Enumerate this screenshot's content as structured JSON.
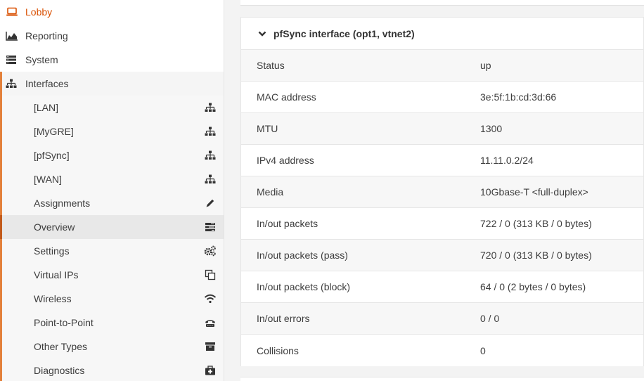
{
  "sidebar": {
    "top_items": [
      {
        "label": "Lobby",
        "icon": "laptop-icon",
        "active": true
      },
      {
        "label": "Reporting",
        "icon": "area-chart-icon"
      },
      {
        "label": "System",
        "icon": "server-icon"
      },
      {
        "label": "Interfaces",
        "icon": "sitemap-icon"
      }
    ],
    "interfaces_submenu": [
      {
        "label": "[LAN]",
        "icon": "sitemap-icon"
      },
      {
        "label": "[MyGRE]",
        "icon": "sitemap-icon"
      },
      {
        "label": "[pfSync]",
        "icon": "sitemap-icon"
      },
      {
        "label": "[WAN]",
        "icon": "sitemap-icon"
      },
      {
        "label": "Assignments",
        "icon": "pencil-icon"
      },
      {
        "label": "Overview",
        "icon": "tasks-icon",
        "selected": true
      },
      {
        "label": "Settings",
        "icon": "cogs-icon"
      },
      {
        "label": "Virtual IPs",
        "icon": "clone-icon"
      },
      {
        "label": "Wireless",
        "icon": "wifi-icon"
      },
      {
        "label": "Point-to-Point",
        "icon": "fax-icon"
      },
      {
        "label": "Other Types",
        "icon": "archive-icon"
      },
      {
        "label": "Diagnostics",
        "icon": "medkit-icon"
      }
    ],
    "accent_color": "#e3813b",
    "active_color": "#d94f00"
  },
  "main": {
    "card": {
      "title": "pfSync interface (opt1, vtnet2)",
      "rows": [
        {
          "key": "Status",
          "value": "up"
        },
        {
          "key": "MAC address",
          "value": "3e:5f:1b:cd:3d:66"
        },
        {
          "key": "MTU",
          "value": "1300"
        },
        {
          "key": "IPv4 address",
          "value": "11.11.0.2/24"
        },
        {
          "key": "Media",
          "value": "10Gbase-T <full-duplex>"
        },
        {
          "key": "In/out packets",
          "value": "722 / 0 (313 KB / 0 bytes)"
        },
        {
          "key": "In/out packets (pass)",
          "value": "720 / 0 (313 KB / 0 bytes)"
        },
        {
          "key": "In/out packets (block)",
          "value": "64 / 0 (2 bytes / 0 bytes)"
        },
        {
          "key": "In/out errors",
          "value": "0 / 0"
        },
        {
          "key": "Collisions",
          "value": "0"
        }
      ]
    }
  }
}
